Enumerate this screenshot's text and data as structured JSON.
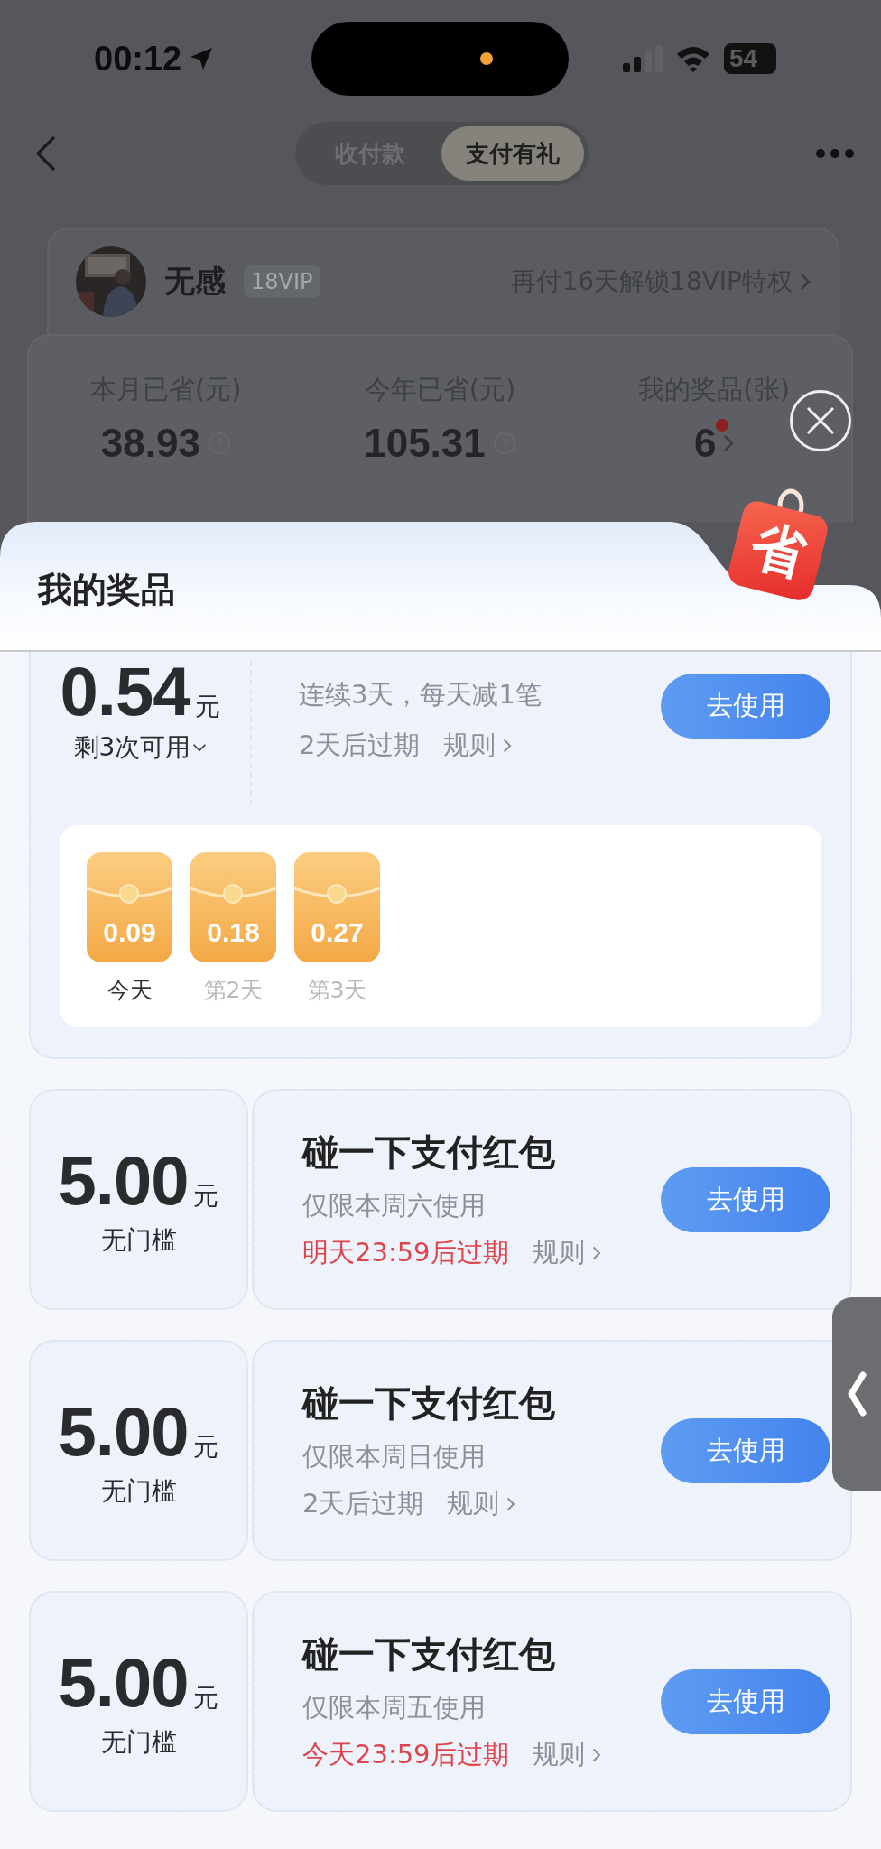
{
  "status_bar": {
    "time": "00:12",
    "battery": "54"
  },
  "nav": {
    "tabs": [
      {
        "label": "收付款",
        "selected": false
      },
      {
        "label": "支付有礼",
        "selected": true
      }
    ]
  },
  "user": {
    "name": "无感",
    "level_badge": "18VIP",
    "upgrade_hint": "再付16天解锁18VIP特权"
  },
  "stats": [
    {
      "label": "本月已省(元)",
      "value": "38.93",
      "kind": "help",
      "has_new": false
    },
    {
      "label": "今年已省(元)",
      "value": "105.31",
      "kind": "help",
      "has_new": false
    },
    {
      "label": "我的奖品(张)",
      "value": "6",
      "kind": "link",
      "has_new": true
    }
  ],
  "sheet": {
    "title": "我的奖品",
    "tag": "省"
  },
  "coupons": [
    {
      "kind": "multi",
      "amount": "0.54",
      "unit": "元",
      "note": "剩3次可用",
      "description": "连续3天，每天减1笔",
      "expiry": "2天后过期",
      "expiry_urgent": false,
      "rules": "规则",
      "action": "去使用",
      "packets": [
        {
          "amount": "0.09",
          "label": "今天",
          "selected": true
        },
        {
          "amount": "0.18",
          "label": "第2天",
          "selected": false
        },
        {
          "amount": "0.27",
          "label": "第3天",
          "selected": false
        }
      ]
    },
    {
      "kind": "single",
      "amount": "5.00",
      "unit": "元",
      "note": "无门槛",
      "title": "碰一下支付红包",
      "description": "仅限本周六使用",
      "expiry": "明天23:59后过期",
      "expiry_urgent": true,
      "rules": "规则",
      "action": "去使用"
    },
    {
      "kind": "single",
      "amount": "5.00",
      "unit": "元",
      "note": "无门槛",
      "title": "碰一下支付红包",
      "description": "仅限本周日使用",
      "expiry": "2天后过期",
      "expiry_urgent": false,
      "rules": "规则",
      "action": "去使用"
    },
    {
      "kind": "single",
      "amount": "5.00",
      "unit": "元",
      "note": "无门槛",
      "title": "碰一下支付红包",
      "description": "仅限本周五使用",
      "expiry": "今天23:59后过期",
      "expiry_urgent": true,
      "rules": "规则",
      "action": "去使用"
    }
  ]
}
